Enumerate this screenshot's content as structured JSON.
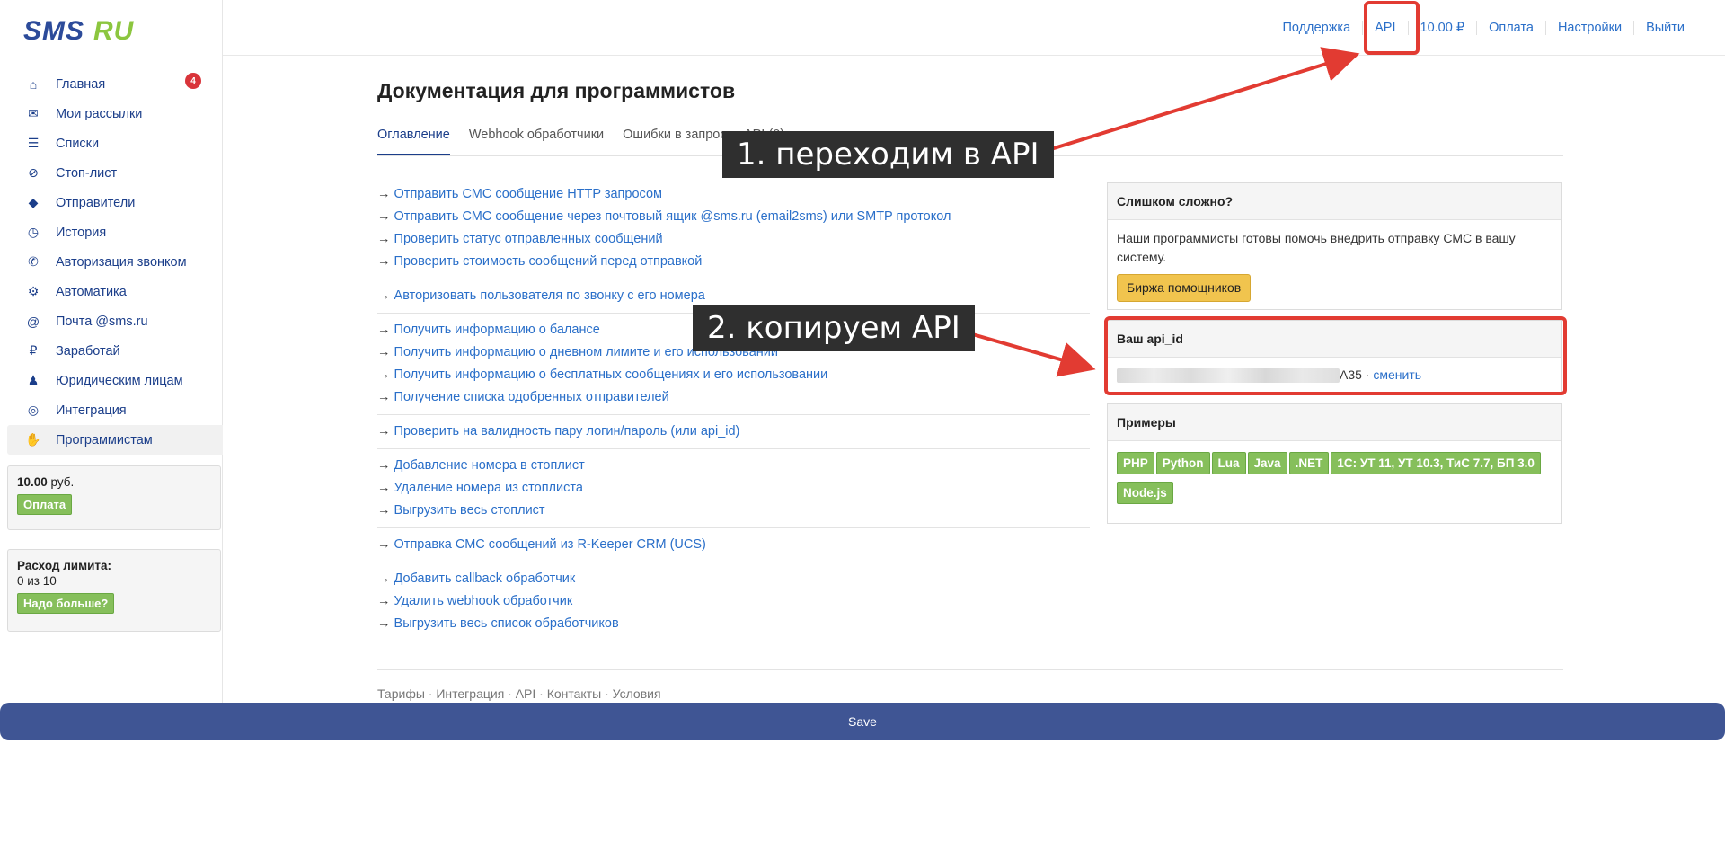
{
  "logo": {
    "text": "SMS.RU"
  },
  "sidebar": {
    "items": [
      {
        "label": "Главная",
        "icon": "home-icon",
        "glyph": "⌂",
        "badge": "4"
      },
      {
        "label": "Мои рассылки",
        "icon": "mailings-icon",
        "glyph": "✉"
      },
      {
        "label": "Списки",
        "icon": "list-icon",
        "glyph": "☰"
      },
      {
        "label": "Стоп-лист",
        "icon": "stoplist-icon",
        "glyph": "⊘"
      },
      {
        "label": "Отправители",
        "icon": "tag-icon",
        "glyph": "◆"
      },
      {
        "label": "История",
        "icon": "history-icon",
        "glyph": "◷"
      },
      {
        "label": "Авторизация звонком",
        "icon": "phone-icon",
        "glyph": "✆"
      },
      {
        "label": "Автоматика",
        "icon": "robot-icon",
        "glyph": "⚙"
      },
      {
        "label": "Почта @sms.ru",
        "icon": "at-icon",
        "glyph": "@"
      },
      {
        "label": "Заработай",
        "icon": "money-icon",
        "glyph": "₽"
      },
      {
        "label": "Юридическим лицам",
        "icon": "person-icon",
        "glyph": "♟"
      },
      {
        "label": "Интеграция",
        "icon": "integration-icon",
        "glyph": "◎"
      },
      {
        "label": "Программистам",
        "icon": "hand-icon",
        "glyph": "✋"
      }
    ],
    "balance": {
      "amount": "10.00",
      "currency": " руб.",
      "pay_label": "Оплата"
    },
    "limit": {
      "title": "Расход лимита:",
      "value": "0 из 10",
      "more_label": "Надо больше?"
    }
  },
  "topnav": {
    "links": [
      "Поддержка",
      "API",
      "10.00 ₽",
      "Оплата",
      "Настройки",
      "Выйти"
    ]
  },
  "main": {
    "title": "Документация для программистов",
    "tabs": [
      "Оглавление",
      "Webhook обработчики",
      "Ошибки в запросах API (0)"
    ],
    "link_groups": [
      [
        "Отправить СМС сообщение HTTP запросом",
        "Отправить СМС сообщение через почтовый ящик @sms.ru (email2sms) или SMTP протокол",
        "Проверить статус отправленных сообщений",
        "Проверить стоимость сообщений перед отправкой"
      ],
      [
        "Авторизовать пользователя по звонку с его номера"
      ],
      [
        "Получить информацию о балансе",
        "Получить информацию о дневном лимите и его использовании",
        "Получить информацию о бесплатных сообщениях и его использовании",
        "Получение списка одобренных отправителей"
      ],
      [
        "Проверить на валидность пару логин/пароль (или api_id)"
      ],
      [
        "Добавление номера в стоплист",
        "Удаление номера из стоплиста",
        "Выгрузить весь стоплист"
      ],
      [
        "Отправка СМС сообщений из R-Keeper CRM (UCS)"
      ],
      [
        "Добавить callback обработчик",
        "Удалить webhook обработчик",
        "Выгрузить весь список обработчиков"
      ]
    ],
    "arrow_prefix": "→ ",
    "footer": "Тарифы · Интеграция · API · Контакты · Условия"
  },
  "panels": {
    "help": {
      "title": "Слишком сложно?",
      "text": "Наши программисты готовы помочь внедрить отправку СМС в вашу систему.",
      "button": "Биржа помощников"
    },
    "api": {
      "title": "Ваш api_id",
      "suffix": "A35 · ",
      "change": "сменить"
    },
    "examples": {
      "title": "Примеры",
      "langs": [
        "PHP",
        "Python",
        "Lua",
        "Java",
        ".NET",
        "1С: УТ 11, УТ 10.3, ТиС 7.7, БП 3.0",
        "Node.js"
      ]
    }
  },
  "annotations": {
    "step1": "1. переходим в API",
    "step2": "2. копируем API",
    "color": "#e23b32"
  },
  "savebar": {
    "label": "Save"
  }
}
